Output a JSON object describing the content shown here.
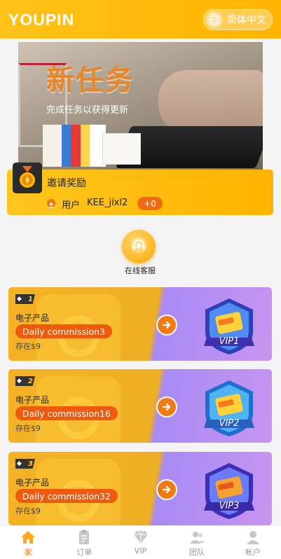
{
  "header": {
    "logo": "YOUPIN",
    "language": "简体中文"
  },
  "banner": {
    "title": "新任务",
    "subtitle": "完成任务以获得更新"
  },
  "invite": {
    "title": "邀请奖励",
    "user_label": "用户",
    "user_name": "KEE_jixl2",
    "badge": "+0"
  },
  "service": {
    "label": "在线客服"
  },
  "vip_cards": [
    {
      "level": "1",
      "title": "电子产品",
      "commission": "Daily commission3",
      "deposit": "存在$9",
      "vip": "VIP1"
    },
    {
      "level": "2",
      "title": "电子产品",
      "commission": "Daily commission16",
      "deposit": "存在$9",
      "vip": "VIP2"
    },
    {
      "level": "3",
      "title": "电子产品",
      "commission": "Daily commission32",
      "deposit": "存在$9",
      "vip": "VIP3"
    }
  ],
  "tabs": [
    {
      "label": "家",
      "icon": "home-icon"
    },
    {
      "label": "订单",
      "icon": "clipboard-icon"
    },
    {
      "label": "VIP",
      "icon": "diamond-icon"
    },
    {
      "label": "团队",
      "icon": "team-icon"
    },
    {
      "label": "帐户",
      "icon": "person-icon"
    }
  ],
  "colors": {
    "brand": "#ffb400",
    "accent": "#f07a10",
    "vip_purple": "#a88bf5"
  }
}
